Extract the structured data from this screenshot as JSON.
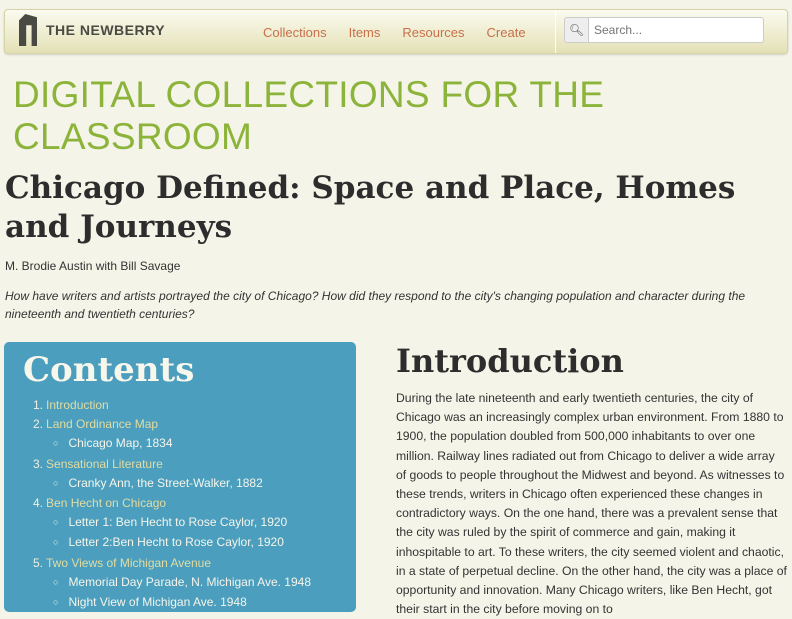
{
  "nav": {
    "logo_text": "THE NEWBERRY",
    "links": [
      "Collections",
      "Items",
      "Resources",
      "Create"
    ],
    "search_placeholder": "Search..."
  },
  "site_title": "DIGITAL COLLECTIONS FOR THE CLASSROOM",
  "page": {
    "title": "Chicago Defined: Space and Place, Homes and Journeys",
    "author": "M. Brodie Austin with Bill Savage",
    "question": "How have writers and artists portrayed the city of Chicago? How did they respond to the city's changing population and character during the nineteenth and twentieth centuries?"
  },
  "contents": {
    "heading": "Contents",
    "items": [
      {
        "num": "1.",
        "label": "Introduction",
        "subs": []
      },
      {
        "num": "2.",
        "label": "Land Ordinance Map",
        "subs": [
          "Chicago Map, 1834"
        ]
      },
      {
        "num": "3.",
        "label": "Sensational Literature",
        "subs": [
          "Cranky Ann, the Street-Walker, 1882"
        ]
      },
      {
        "num": "4.",
        "label": "Ben Hecht on Chicago",
        "subs": [
          "Letter 1: Ben Hecht to Rose Caylor, 1920",
          "Letter 2:Ben Hecht to Rose Caylor, 1920"
        ]
      },
      {
        "num": "5.",
        "label": "Two Views of Michigan Avenue",
        "subs": [
          "Memorial Day Parade, N. Michigan Ave. 1948",
          "Night View of Michigan Ave. 1948"
        ]
      }
    ]
  },
  "intro": {
    "heading": "Introduction",
    "text": "During the late nineteenth and early twentieth centuries, the city of Chicago was an increasingly complex urban environment. From 1880 to 1900, the population doubled from 500,000 inhabitants to over one million. Railway lines radiated out from Chicago to deliver a wide array of goods to people throughout the Midwest and beyond. As witnesses to these trends, writers in Chicago often experienced these changes in contradictory ways. On the one hand, there was a prevalent sense that the city was ruled by the spirit of commerce and gain, making it inhospitable to art. To these writers, the city seemed violent and chaotic, in a state of perpetual decline. On the other hand, the city was a place of opportunity and innovation. Many Chicago writers, like Ben Hecht, got their start in the city before moving on to"
  }
}
